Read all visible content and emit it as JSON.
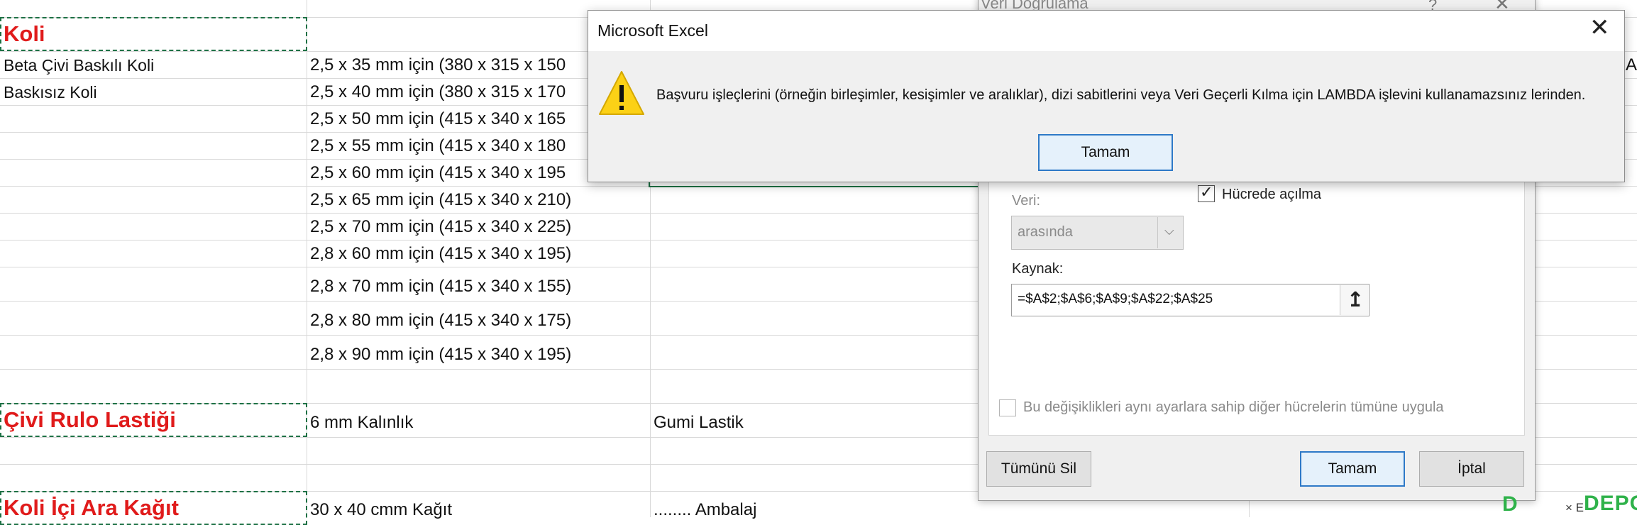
{
  "sheet": {
    "column_a": [
      {
        "id": "koli",
        "text": "Koli",
        "style": "red"
      },
      {
        "id": "beta",
        "text": "Beta Çivi Baskılı Koli",
        "style": "plain"
      },
      {
        "id": "baskisiz",
        "text": "Baskısız Koli",
        "style": "plain"
      },
      {
        "id": "civi",
        "text": "Çivi Rulo Lastiği",
        "style": "red"
      },
      {
        "id": "ara",
        "text": "Koli İçi Ara Kağıt",
        "style": "red"
      }
    ],
    "column_b": [
      "2,5 x 35 mm için (380 x 315 x 150",
      "2,5 x 40 mm için (380 x 315 x 170",
      "2,5 x 50 mm için (415 x 340 x 165",
      "2,5 x 55 mm için (415 x 340 x 180",
      "2,5 x 60 mm için (415 x 340 x 195",
      "2,5 x 65 mm için (415 x 340 x 210)",
      "2,5 x 70 mm için (415 x 340 x 225)",
      "2,8 x 60 mm için (415 x 340 x 195)",
      "2,8 x 70 mm için (415 x 340 x 155)",
      "2,8 x 80 mm için (415 x 340 x 175)",
      "2,8 x 90 mm için (415 x 340 x 195)",
      "6 mm Kalınlık",
      "30 x 40 cmm Kağıt"
    ],
    "column_c": [
      "Gumi Lastik",
      "........ Ambalaj"
    ],
    "right_edge_text": "A"
  },
  "validation_dialog": {
    "title": "Veri Doğrulama",
    "help": "?",
    "close": "✕",
    "in_cell_dropdown_label": "Hücrede açılma",
    "in_cell_dropdown_checked": true,
    "data_label": "Veri:",
    "data_value": "arasında",
    "source_label": "Kaynak:",
    "source_value": "=$A$2;$A$6;$A$9;$A$22;$A$25",
    "apply_all_label": "Bu değişiklikleri aynı ayarlara sahip diğer hücrelerin tümüne uygula",
    "apply_all_checked": false,
    "clear_all_button": "Tümünü Sil",
    "ok_button": "Tamam",
    "cancel_button": "İptal"
  },
  "message_box": {
    "title": "Microsoft Excel",
    "close": "✕",
    "message": "Başvuru işleçlerini (örneğin birleşimler, kesişimler ve aralıklar), dizi sabitlerini veya Veri Geçerli Kılma için LAMBDA işlevini kullanamazsınız lerinden.",
    "icon": "warning-icon",
    "ok_button": "Tamam"
  },
  "watermark": {
    "brand": "DEPO",
    "left_glyph": "D",
    "x_text": "× E"
  }
}
